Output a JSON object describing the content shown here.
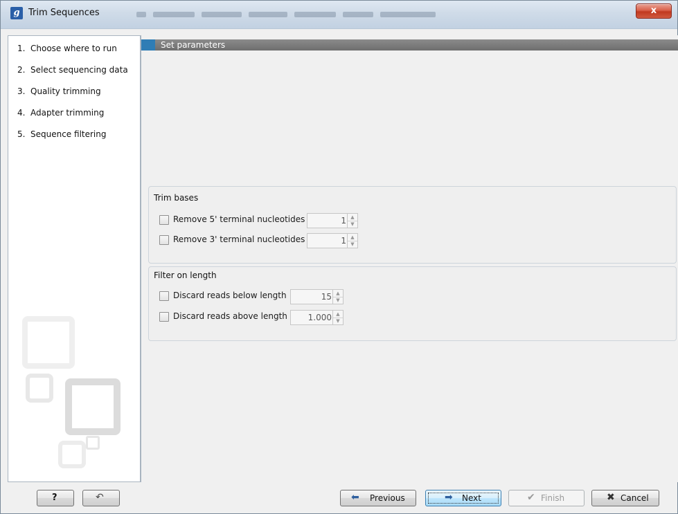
{
  "window": {
    "title": "Trim Sequences",
    "app_icon_letter": "g",
    "close_glyph": "x",
    "accent_color": "#2f7db5"
  },
  "steps": [
    {
      "num": "1.",
      "label": "Choose where to run"
    },
    {
      "num": "2.",
      "label": "Select sequencing data"
    },
    {
      "num": "3.",
      "label": "Quality trimming"
    },
    {
      "num": "4.",
      "label": "Adapter trimming"
    },
    {
      "num": "5.",
      "label": "Sequence filtering"
    }
  ],
  "section": {
    "title": "Set parameters"
  },
  "trim_bases": {
    "title": "Trim bases",
    "options": [
      {
        "label": "Remove 5' terminal nucleotides",
        "checked": false,
        "value": "1"
      },
      {
        "label": "Remove 3' terminal nucleotides",
        "checked": false,
        "value": "1"
      }
    ]
  },
  "filter_length": {
    "title": "Filter on length",
    "options": [
      {
        "label": "Discard reads below length",
        "checked": false,
        "value": "15"
      },
      {
        "label": "Discard reads above length",
        "checked": false,
        "value": "1.000"
      }
    ]
  },
  "footer": {
    "help_label": "?",
    "reset_icon": "undo-arrow",
    "previous_label": "Previous",
    "next_label": "Next",
    "finish_label": "Finish",
    "cancel_label": "Cancel"
  }
}
